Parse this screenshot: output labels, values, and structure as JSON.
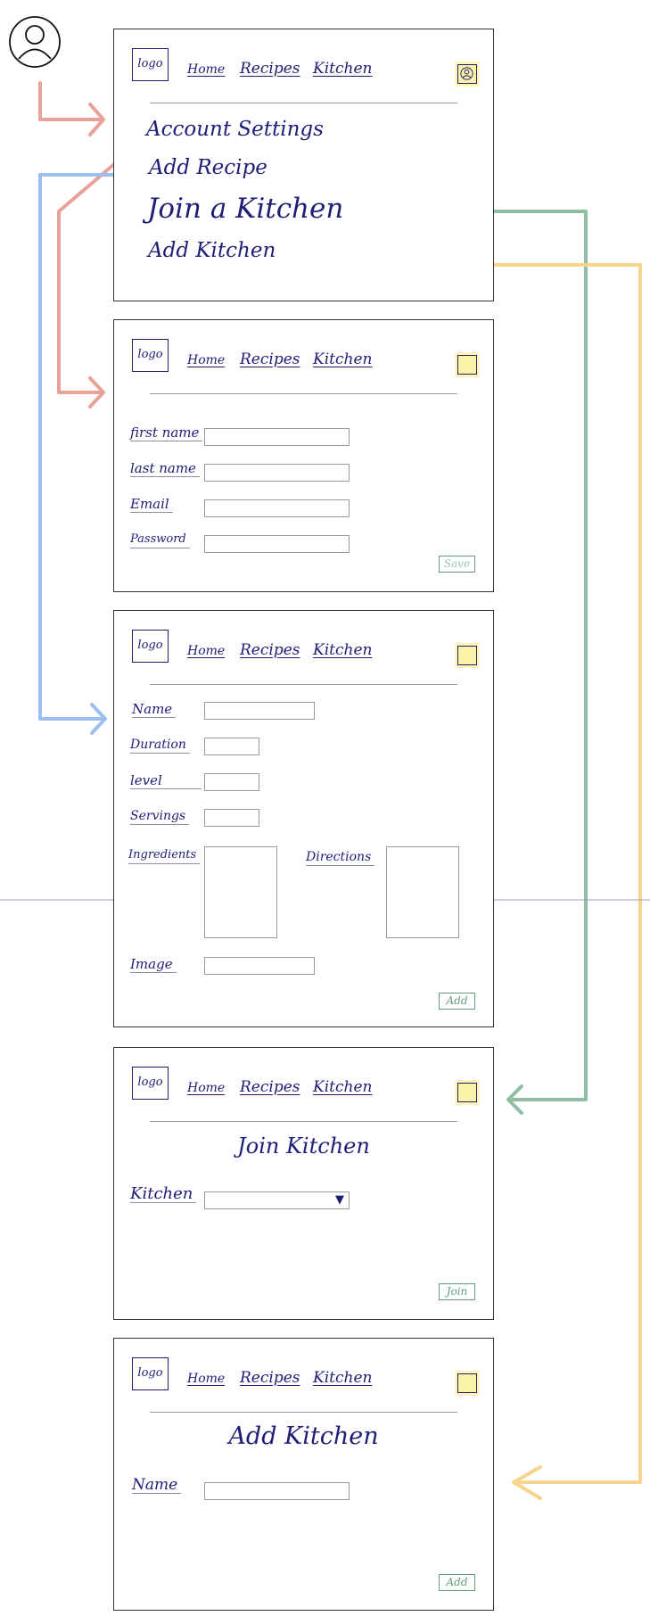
{
  "nav": {
    "logo": "logo",
    "home": "Home",
    "recipes": "Recipes",
    "kitchen": "Kitchen"
  },
  "menu": {
    "account_settings": "Account Settings",
    "add_recipe": "Add Recipe",
    "join_kitchen": "Join a Kitchen",
    "add_kitchen": "Add Kitchen"
  },
  "account_form": {
    "first_name": "first name",
    "last_name": "last name",
    "email": "Email",
    "password": "Password",
    "save": "Save"
  },
  "recipe_form": {
    "name": "Name",
    "duration": "Duration",
    "level": "level",
    "servings": "Servings",
    "ingredients": "Ingredients",
    "directions": "Directions",
    "image": "Image",
    "add": "Add"
  },
  "join_kitchen": {
    "title": "Join Kitchen",
    "kitchen_label": "Kitchen",
    "join": "Join"
  },
  "add_kitchen": {
    "title": "Add Kitchen",
    "name": "Name",
    "add": "Add"
  },
  "colors": {
    "account_arrow": "#e8a29a",
    "recipe_arrow": "#9dbff0",
    "join_arrow": "#8fbfa3",
    "addkitchen_arrow": "#f5d48c"
  }
}
